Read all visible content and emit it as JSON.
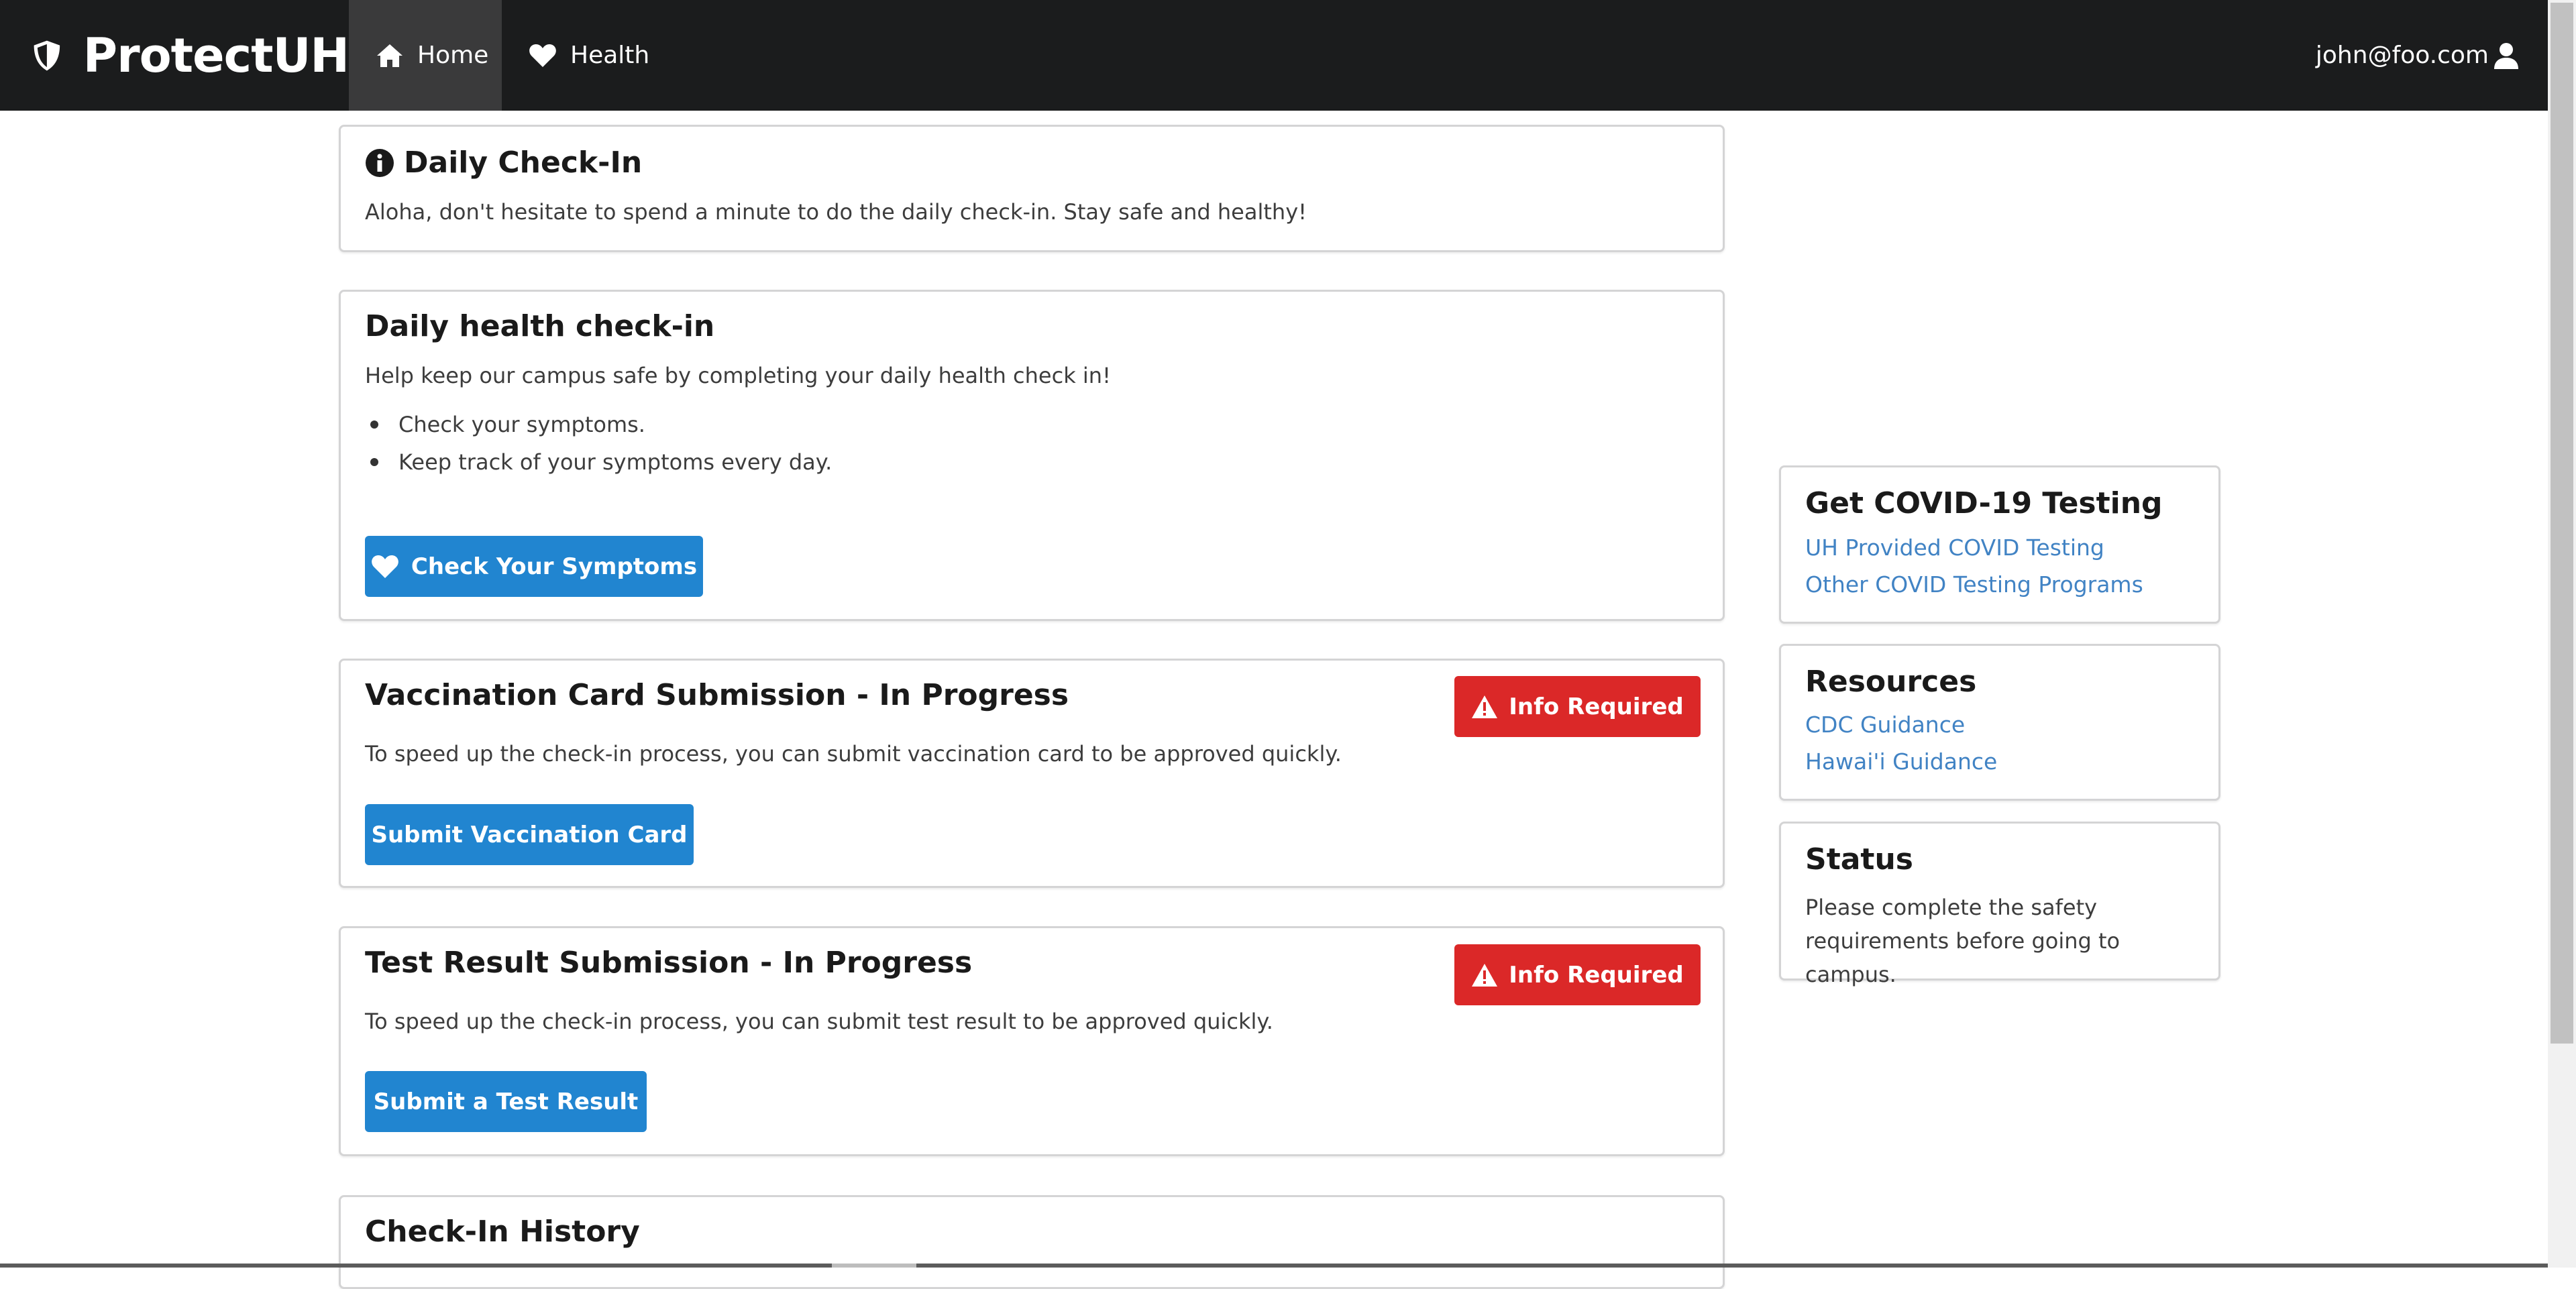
{
  "navbar": {
    "brand": "ProtectUH",
    "items": [
      {
        "label": "Home",
        "icon": "home-icon",
        "active": true
      },
      {
        "label": "Health",
        "icon": "heart-icon",
        "active": false
      }
    ],
    "user_email": "john@foo.com",
    "user_icon": "user-icon",
    "background": "#1b1c1d"
  },
  "daily_checkin_notice": {
    "title": "Daily Check-In",
    "icon": "info-circle-icon",
    "text": "Aloha, don't hesitate to spend a minute to do the daily check-in. Stay safe and healthy!"
  },
  "health_checkin": {
    "title": "Daily health check-in",
    "description": "Help keep our campus safe by completing your daily health check in!",
    "bullets": [
      "Check your symptoms.",
      "Keep track of your symptoms every day."
    ],
    "button_label": "Check Your Symptoms",
    "button_icon": "heart-icon"
  },
  "vaccination": {
    "title": "Vaccination Card Submission - In Progress",
    "badge": "Info Required",
    "badge_icon": "warning-icon",
    "description": "To speed up the check-in process, you can submit vaccination card to be approved quickly.",
    "button_label": "Submit Vaccination Card"
  },
  "test_result": {
    "title": "Test Result Submission - In Progress",
    "badge": "Info Required",
    "badge_icon": "warning-icon",
    "description": "To speed up the check-in process, you can submit test result to be approved quickly.",
    "button_label": "Submit a Test Result"
  },
  "history": {
    "title": "Check-In History"
  },
  "sidebar": {
    "testing": {
      "title": "Get COVID-19 Testing",
      "links": [
        "UH Provided COVID Testing",
        "Other COVID Testing Programs"
      ]
    },
    "resources": {
      "title": "Resources",
      "links": [
        "CDC Guidance",
        "Hawai'i Guidance"
      ]
    },
    "status": {
      "title": "Status",
      "text": "Please complete the safety requirements before going to campus."
    }
  },
  "colors": {
    "primary_button": "#2185d0",
    "badge_red": "#db2828",
    "link_blue": "#4183c4"
  }
}
